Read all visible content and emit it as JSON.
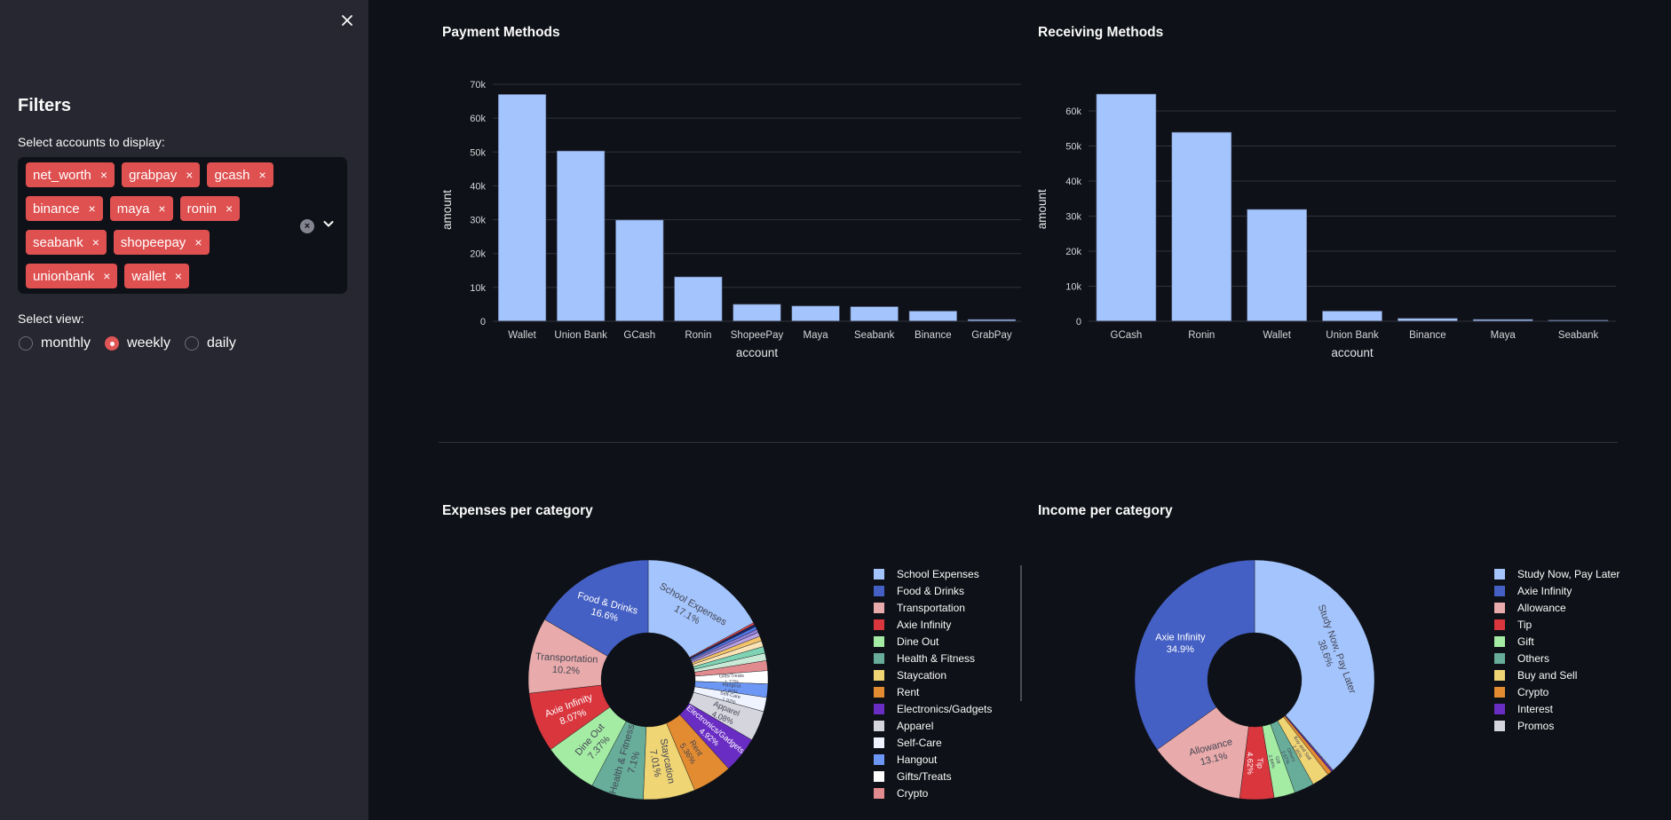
{
  "sidebar": {
    "close_label": "×",
    "title": "Filters",
    "accounts_label": "Select accounts to display:",
    "accounts": [
      "net_worth",
      "grabpay",
      "gcash",
      "binance",
      "maya",
      "ronin",
      "seabank",
      "shopeepay",
      "unionbank",
      "wallet"
    ],
    "chip_remove_glyph": "×",
    "clear_all_glyph": "×",
    "view_label": "Select view:",
    "view_options": [
      {
        "label": "monthly",
        "selected": false
      },
      {
        "label": "weekly",
        "selected": true
      },
      {
        "label": "daily",
        "selected": false
      }
    ]
  },
  "colors": {
    "sidebar_bg": "#262730",
    "main_bg": "#0e1117",
    "chip": "#df5050",
    "bar": "#a3c4fc"
  },
  "chart_data": [
    {
      "id": "payment",
      "type": "bar",
      "title": "Payment Methods",
      "xlabel": "account",
      "ylabel": "amount",
      "categories": [
        "Wallet",
        "Union Bank",
        "GCash",
        "Ronin",
        "ShopeePay",
        "Maya",
        "Seabank",
        "Binance",
        "GrabPay"
      ],
      "values": [
        67000,
        50300,
        29900,
        13100,
        5000,
        4500,
        4300,
        3000,
        500
      ],
      "ylim": [
        0,
        70000
      ],
      "yticks": [
        0,
        10000,
        20000,
        30000,
        40000,
        50000,
        60000,
        70000
      ],
      "ytick_labels": [
        "0",
        "10k",
        "20k",
        "30k",
        "40k",
        "50k",
        "60k",
        "70k"
      ],
      "grid": true
    },
    {
      "id": "receiving",
      "type": "bar",
      "title": "Receiving Methods",
      "xlabel": "account",
      "ylabel": "amount",
      "categories": [
        "GCash",
        "Ronin",
        "Wallet",
        "Union Bank",
        "Binance",
        "Maya",
        "Seabank"
      ],
      "values": [
        64800,
        53900,
        31900,
        2900,
        800,
        500,
        300
      ],
      "ylim": [
        0,
        68000
      ],
      "yticks": [
        0,
        10000,
        20000,
        30000,
        40000,
        50000,
        60000
      ],
      "ytick_labels": [
        "0",
        "10k",
        "20k",
        "30k",
        "40k",
        "50k",
        "60k"
      ],
      "grid": true
    },
    {
      "id": "expenses",
      "type": "pie",
      "title": "Expenses per category",
      "hole": true,
      "legend_position": "right",
      "labels": [
        "School Expenses",
        "Food & Drinks",
        "Transportation",
        "Axie Infinity",
        "Dine Out",
        "Health & Fitness",
        "Staycation",
        "Rent",
        "Electronics/Gadgets",
        "Apparel",
        "Self-Care",
        "Hangout",
        "Gifts/Treats",
        "Crypto"
      ],
      "values": [
        17.1,
        16.6,
        10.2,
        8.07,
        7.37,
        7.1,
        7.01,
        5.36,
        4.92,
        4.08,
        1.92,
        1.82,
        1.77,
        1.35
      ],
      "colors": [
        "#a3c4fc",
        "#4560c4",
        "#e8aaaa",
        "#d9363e",
        "#a4eca4",
        "#67ad9a",
        "#f0d575",
        "#e38b30",
        "#6a2dc3",
        "#d5d5de",
        "#eef3ff",
        "#6c97f5",
        "#ffffff",
        "#e28b8f"
      ],
      "text_labels": [
        "School Expenses\n17.1%",
        "Food & Drinks\n16.6%",
        "Transportation\n10.2%",
        "Axie Infinity\n8.07%",
        "Dine Out\n7.37%",
        "Health & Fitness\n7.1%",
        "Staycation\n7.01%",
        "Rent\n5.36%",
        "Electronics/Gadgets\n4.92%",
        "Apparel\n4.08%",
        "Self-Care\n1.92%",
        "Hangout\n1.82%",
        "Gifts/Treats\n1.77%",
        ""
      ],
      "unlabeled_slices": {
        "values": [
          1.0,
          0.9,
          0.8,
          0.65,
          0.55,
          0.45,
          0.4,
          0.33,
          0.25
        ],
        "colors": [
          "#c9ead6",
          "#7fd3b5",
          "#fbe3b8",
          "#f2c36b",
          "#b8a2e6",
          "#8f7fd6",
          "#5079ea",
          "#1e2a66",
          "#ef4b4b"
        ]
      }
    },
    {
      "id": "income",
      "type": "pie",
      "title": "Income per category",
      "hole": true,
      "legend_position": "right",
      "labels": [
        "Study Now, Pay Later",
        "Axie Infinity",
        "Allowance",
        "Tip",
        "Gift",
        "Others",
        "Buy and Sell",
        "Crypto",
        "Interest",
        "Promos"
      ],
      "values": [
        38.6,
        34.9,
        13.1,
        4.62,
        2.84,
        2.67,
        2.35,
        0.6,
        0.22,
        0.1
      ],
      "colors": [
        "#a3c4fc",
        "#4560c4",
        "#e8aaaa",
        "#d9363e",
        "#a4eca4",
        "#67ad9a",
        "#f0d575",
        "#e38b30",
        "#6a2dc3",
        "#d5d5de"
      ],
      "text_labels": [
        "Study Now, Pay Later\n38.6%",
        "Axie Infinity\n34.9%",
        "Allowance\n13.1%",
        "Tip\n4.62%",
        "Gift\n2.84%",
        "Others\n2.67%",
        "Buy and Sell\n2.35%",
        "",
        "",
        ""
      ]
    }
  ]
}
